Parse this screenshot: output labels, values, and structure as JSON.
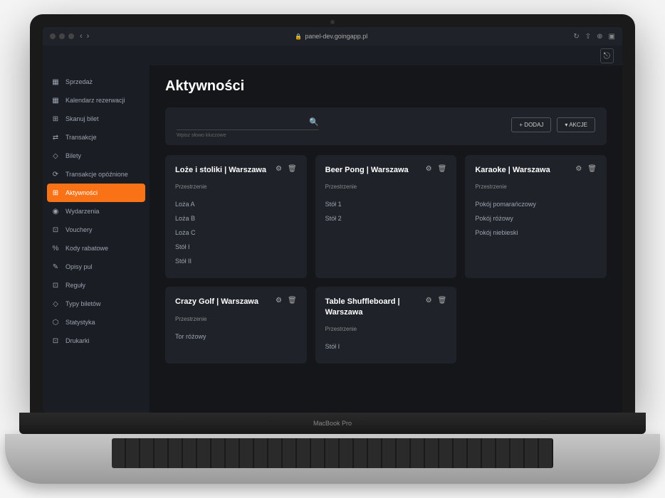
{
  "browser": {
    "url": "panel-dev.goingapp.pl"
  },
  "page": {
    "title": "Aktywności"
  },
  "search": {
    "placeholder": "",
    "hint": "Wpisz słowo kluczowe"
  },
  "buttons": {
    "add": "+ DODAJ",
    "actions": "▾  AKCJE"
  },
  "sidebar": {
    "items": [
      {
        "icon": "▦",
        "label": "Sprzedaż"
      },
      {
        "icon": "▦",
        "label": "Kalendarz rezerwacji"
      },
      {
        "icon": "⊞",
        "label": "Skanuj bilet"
      },
      {
        "icon": "⇄",
        "label": "Transakcje"
      },
      {
        "icon": "◇",
        "label": "Bilety"
      },
      {
        "icon": "⟳",
        "label": "Transakcje opóźnione"
      },
      {
        "icon": "⊞",
        "label": "Aktywności",
        "active": true
      },
      {
        "icon": "◉",
        "label": "Wydarzenia"
      },
      {
        "icon": "⊡",
        "label": "Vouchery"
      },
      {
        "icon": "%",
        "label": "Kody rabatowe"
      },
      {
        "icon": "✎",
        "label": "Opisy pul"
      },
      {
        "icon": "⊡",
        "label": "Reguły"
      },
      {
        "icon": "◇",
        "label": "Typy biletów"
      },
      {
        "icon": "⬡",
        "label": "Statystyka"
      },
      {
        "icon": "⊡",
        "label": "Drukarki"
      }
    ]
  },
  "spacesLabel": "Przestrzenie",
  "cards": [
    {
      "title": "Loże i stoliki | Warszawa",
      "spaces": [
        "Loża A",
        "Loża B",
        "Loża C",
        "Stół I",
        "Stół II"
      ]
    },
    {
      "title": "Beer Pong | Warszawa",
      "spaces": [
        "Stół 1",
        "Stół 2"
      ]
    },
    {
      "title": "Karaoke | Warszawa",
      "spaces": [
        "Pokój pomarańczowy",
        "Pokój różowy",
        "Pokój niebieski"
      ]
    },
    {
      "title": "Crazy Golf | Warszawa",
      "spaces": [
        "Tor różowy"
      ]
    },
    {
      "title": "Table Shuffleboard | Warszawa",
      "spaces": [
        "Stół I"
      ]
    }
  ],
  "device": "MacBook Pro"
}
